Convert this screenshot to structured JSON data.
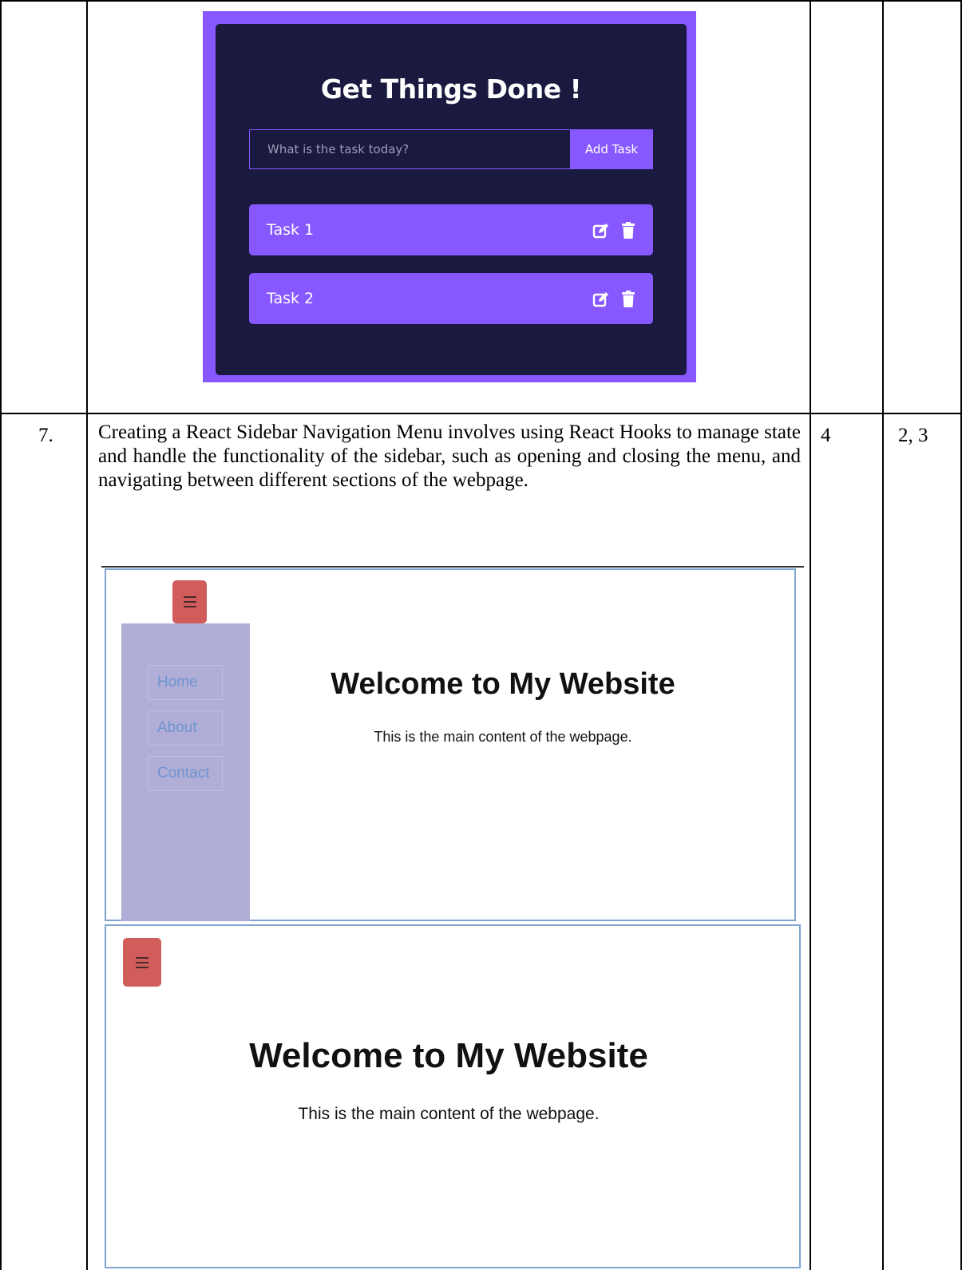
{
  "todo_app": {
    "title": "Get Things Done !",
    "input_placeholder": "What is the task today?",
    "add_button": "Add Task",
    "tasks": [
      {
        "label": "Task 1"
      },
      {
        "label": "Task 2"
      }
    ]
  },
  "row7": {
    "number": "7.",
    "description": "Creating a React Sidebar Navigation Menu involves using React Hooks to manage state and handle the functionality of the sidebar, such as opening and closing the menu, and navigating between different sections of the webpage.",
    "marks": "4",
    "co": "2, 3"
  },
  "sidebar_open_demo": {
    "nav_items": [
      {
        "label": "Home"
      },
      {
        "label": "About"
      },
      {
        "label": "Contact"
      }
    ],
    "heading": "Welcome to My Website",
    "subtext": "This is the main content of the webpage."
  },
  "sidebar_closed_demo": {
    "heading": "Welcome to My Website",
    "subtext": "This is the main content of the webpage."
  },
  "colors": {
    "todo_accent": "#8758ff",
    "todo_card": "#1a1a40",
    "sidebar_bg": "#b0aed6",
    "menu_button": "#d05c5c"
  }
}
